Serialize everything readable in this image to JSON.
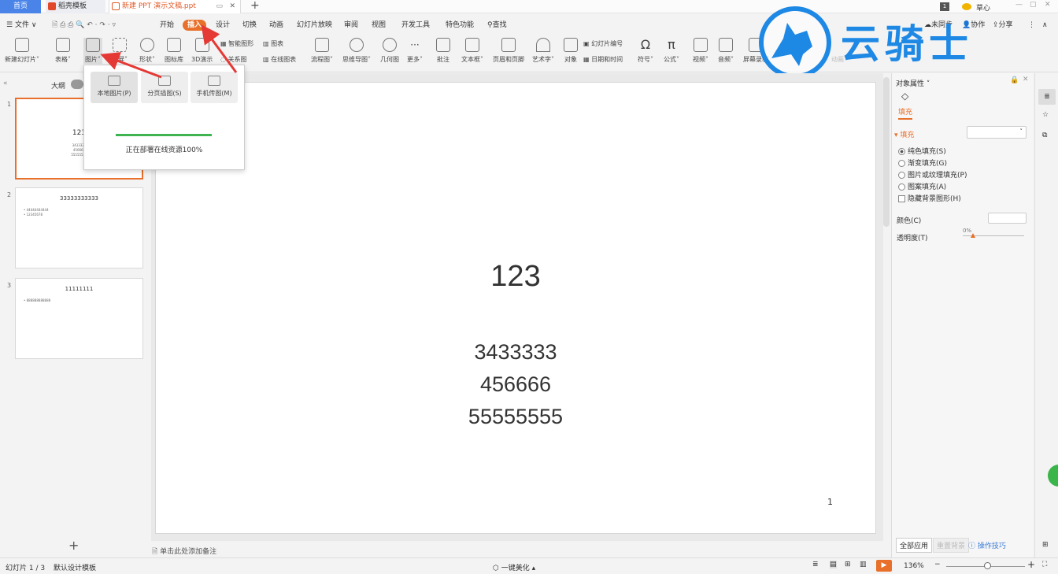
{
  "titlebar": {
    "home": "首页",
    "templates": "稻壳模板",
    "doc": "新建 PPT 演示文稿.ppt",
    "user": "草心",
    "new_tab": "+"
  },
  "menubar": {
    "file": "文件",
    "items": [
      "开始",
      "插入",
      "设计",
      "切换",
      "动画",
      "幻灯片放映",
      "审阅",
      "视图",
      "开发工具",
      "特色功能"
    ],
    "search": "查找",
    "sync": "未同步",
    "collab": "协作",
    "share": "分享"
  },
  "ribbon": {
    "buttons": [
      "新建幻灯片",
      "表格",
      "图片",
      "截屏",
      "形状",
      "图标库",
      "3D演示",
      "流程图",
      "思维导图",
      "几何图",
      "更多",
      "批注",
      "文本框",
      "页眉和页脚",
      "艺术字",
      "对象",
      "符号",
      "公式",
      "视频",
      "音频",
      "屏幕录制"
    ],
    "smart": "智能图形",
    "chart": "图表",
    "relation": "关系图",
    "online_chart": "在线图表",
    "slide_num": "幻灯片编号",
    "datetime": "日期和时间",
    "anim": "动画"
  },
  "watermark": {
    "text": "云骑士"
  },
  "leftpanel": {
    "outline": "大纲",
    "add": "+",
    "slides": [
      {
        "num": "1",
        "title": "123",
        "lines": [
          "3433333",
          "456666",
          "55555555"
        ]
      },
      {
        "num": "2",
        "title": "33333333333",
        "lines": [
          "• 44444444444",
          "• 12345678"
        ]
      },
      {
        "num": "3",
        "title": "11111111",
        "lines": [
          "• 888888888888"
        ]
      }
    ]
  },
  "slide": {
    "title": "123",
    "lines": [
      "3433333",
      "456666",
      "55555555"
    ],
    "page": "1"
  },
  "notes": "单击此处添加备注",
  "dropdown": {
    "local": "本地图片(P)",
    "paged": "分页插图(S)",
    "phone": "手机传图(M)",
    "status": "正在部署在线资源100%",
    "progress": 1.0
  },
  "rightpanel": {
    "title": "对象属性",
    "tab": "填充",
    "section": "填充",
    "options": [
      "纯色填充(S)",
      "渐变填充(G)",
      "图片或纹理填充(P)",
      "图案填充(A)"
    ],
    "hide_bg": "隐藏背景图形(H)",
    "color": "颜色(C)",
    "transparency": "透明度(T)",
    "trans_value": "0%",
    "apply_all": "全部应用",
    "reset_bg": "重置背景",
    "tips": "操作技巧"
  },
  "status": {
    "slide": "幻灯片 1 / 3",
    "template": "默认设计模板",
    "beautify": "一键美化",
    "zoom": "136%"
  },
  "colors": {
    "accent": "#e8702a",
    "arrow": "#e53935",
    "progress": "#3fb34f",
    "brand": "#1e88e5"
  }
}
